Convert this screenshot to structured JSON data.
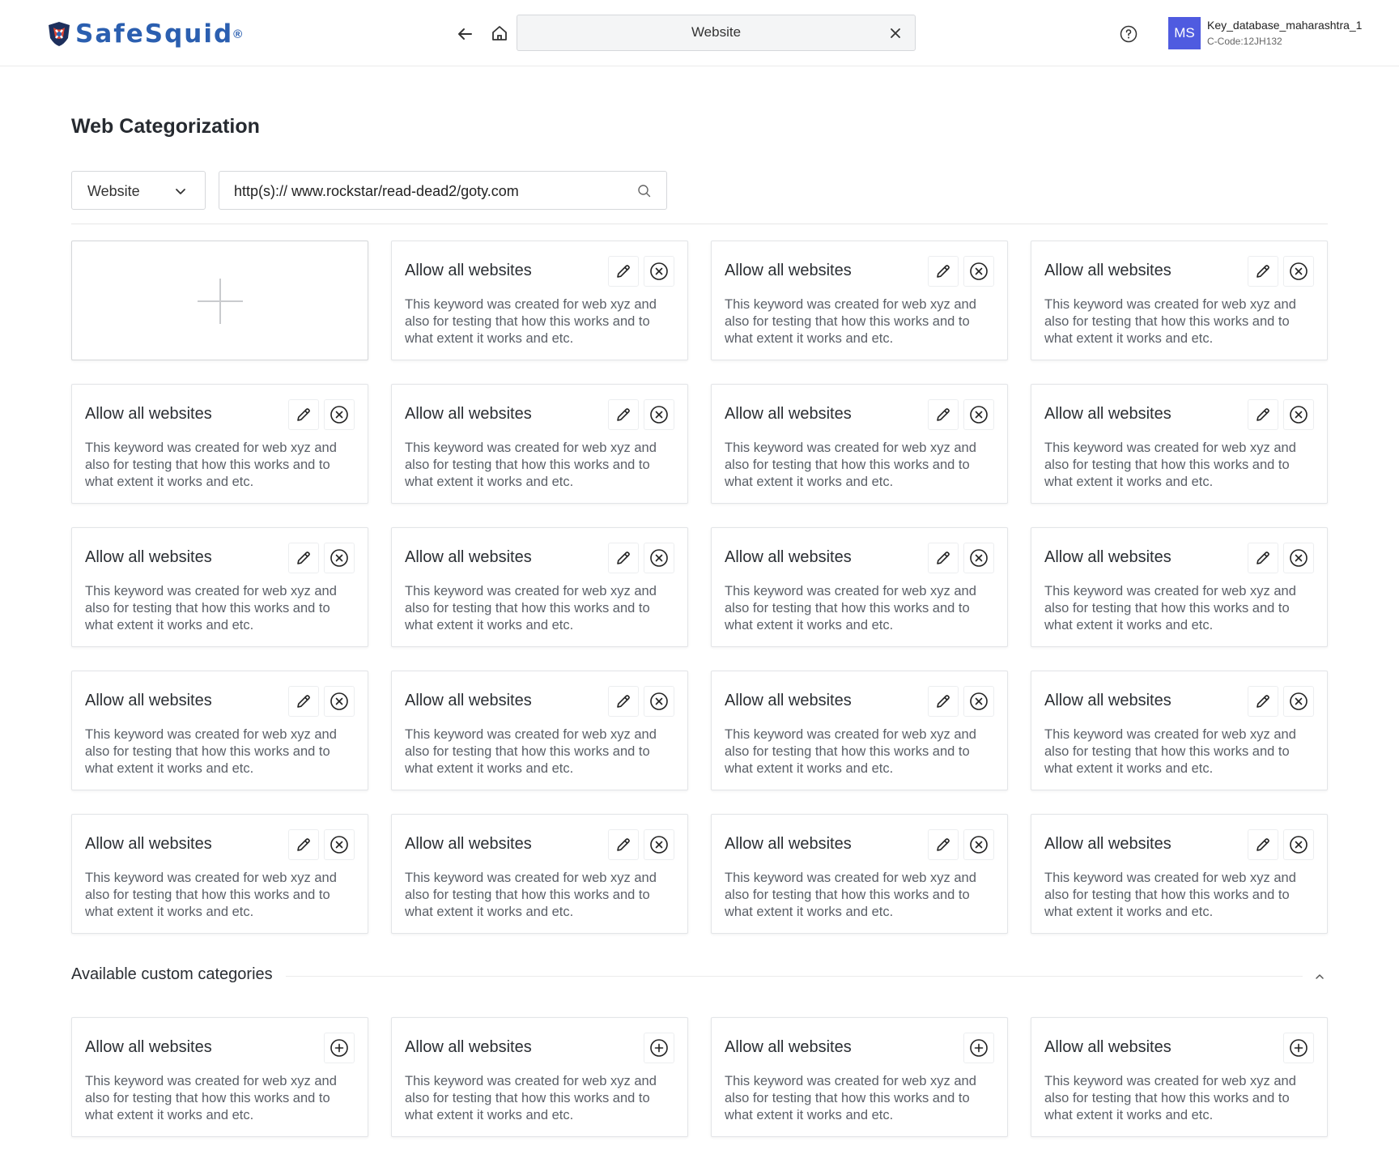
{
  "header": {
    "logo_text": "SafeSquid",
    "logo_mark": "®",
    "tab_label": "Website",
    "user_initials": "MS",
    "user_name": "Key_database_maharashtra_1",
    "user_code": "C-Code:12JH132"
  },
  "page": {
    "title": "Web Categorization",
    "filter_type": "Website",
    "search_value": "http(s):// www.rockstar/read-dead2/goty.com"
  },
  "categories": [
    {
      "title": "Allow all websites",
      "desc": "This keyword was created for web xyz and also for testing that how this works and to what extent it works and etc."
    },
    {
      "title": "Allow all websites",
      "desc": "This keyword was created for web xyz and also for testing that how this works and to what extent it works and etc."
    },
    {
      "title": "Allow all websites",
      "desc": "This keyword was created for web xyz and also for testing that how this works and to what extent it works and etc."
    },
    {
      "title": "Allow all websites",
      "desc": "This keyword was created for web xyz and also for testing that how this works and to what extent it works and etc."
    },
    {
      "title": "Allow all websites",
      "desc": "This keyword was created for web xyz and also for testing that how this works and to what extent it works and etc."
    },
    {
      "title": "Allow all websites",
      "desc": "This keyword was created for web xyz and also for testing that how this works and to what extent it works and etc."
    },
    {
      "title": "Allow all websites",
      "desc": "This keyword was created for web xyz and also for testing that how this works and to what extent it works and etc."
    },
    {
      "title": "Allow all websites",
      "desc": "This keyword was created for web xyz and also for testing that how this works and to what extent it works and etc."
    },
    {
      "title": "Allow all websites",
      "desc": "This keyword was created for web xyz and also for testing that how this works and to what extent it works and etc."
    },
    {
      "title": "Allow all websites",
      "desc": "This keyword was created for web xyz and also for testing that how this works and to what extent it works and etc."
    },
    {
      "title": "Allow all websites",
      "desc": "This keyword was created for web xyz and also for testing that how this works and to what extent it works and etc."
    },
    {
      "title": "Allow all websites",
      "desc": "This keyword was created for web xyz and also for testing that how this works and to what extent it works and etc."
    },
    {
      "title": "Allow all websites",
      "desc": "This keyword was created for web xyz and also for testing that how this works and to what extent it works and etc."
    },
    {
      "title": "Allow all websites",
      "desc": "This keyword was created for web xyz and also for testing that how this works and to what extent it works and etc."
    },
    {
      "title": "Allow all websites",
      "desc": "This keyword was created for web xyz and also for testing that how this works and to what extent it works and etc."
    },
    {
      "title": "Allow all websites",
      "desc": "This keyword was created for web xyz and also for testing that how this works and to what extent it works and etc."
    },
    {
      "title": "Allow all websites",
      "desc": "This keyword was created for web xyz and also for testing that how this works and to what extent it works and etc."
    },
    {
      "title": "Allow all websites",
      "desc": "This keyword was created for web xyz and also for testing that how this works and to what extent it works and etc."
    },
    {
      "title": "Allow all websites",
      "desc": "This keyword was created for web xyz and also for testing that how this works and to what extent it works and etc."
    }
  ],
  "available": {
    "title": "Available custom categories",
    "items": [
      {
        "title": "Allow all websites",
        "desc": "This keyword was created for web xyz and also for testing that how this works and to what extent it works and etc."
      },
      {
        "title": "Allow all websites",
        "desc": "This keyword was created for web xyz and also for testing that how this works and to what extent it works and etc."
      },
      {
        "title": "Allow all websites",
        "desc": "This keyword was created for web xyz and also for testing that how this works and to what extent it works and etc."
      },
      {
        "title": "Allow all websites",
        "desc": "This keyword was created for web xyz and also for testing that how this works and to what extent it works and etc."
      }
    ]
  },
  "icons": {
    "back": "arrow-left-icon",
    "home": "home-icon",
    "close": "close-icon",
    "help": "help-circle-icon",
    "edit": "pencil-icon",
    "delete": "circle-x-icon",
    "add": "circle-plus-icon",
    "search": "search-icon",
    "dropdown": "chevron-down-icon",
    "collapse": "chevron-up-icon"
  },
  "colors": {
    "avatar_bg": "#4f5be0",
    "brand": "#2b5fb0"
  }
}
